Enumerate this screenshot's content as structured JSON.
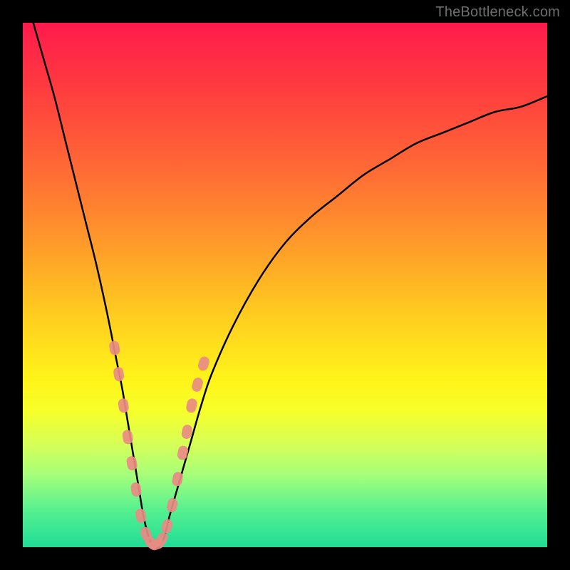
{
  "watermark": "TheBottleneck.com",
  "colors": {
    "frame": "#000000",
    "curve": "#000000",
    "marker_fill": "#e98b84",
    "marker_stroke": "#e98b84"
  },
  "chart_data": {
    "type": "line",
    "title": "",
    "xlabel": "",
    "ylabel": "",
    "xlim": [
      0,
      100
    ],
    "ylim": [
      0,
      100
    ],
    "grid": false,
    "legend": false,
    "series": [
      {
        "name": "bottleneck-curve",
        "x": [
          2,
          4,
          6,
          8,
          10,
          12,
          14,
          16,
          18,
          19,
          20,
          21,
          22,
          23,
          24,
          25,
          26,
          27,
          28,
          30,
          32,
          34,
          36,
          40,
          45,
          50,
          55,
          60,
          65,
          70,
          75,
          80,
          85,
          90,
          95,
          100
        ],
        "y": [
          100,
          93,
          86,
          78,
          70,
          62,
          54,
          45,
          35,
          30,
          24,
          18,
          12,
          6,
          2,
          0,
          0,
          2,
          6,
          13,
          20,
          27,
          33,
          42,
          51,
          58,
          63,
          67,
          71,
          74,
          77,
          79,
          81,
          83,
          84,
          86
        ]
      }
    ],
    "annotations": [
      {
        "type": "markers",
        "shape": "capsule",
        "comment": "salmon capsule markers along the lower V of the curve",
        "points_xy": [
          [
            17.5,
            38
          ],
          [
            18.3,
            33
          ],
          [
            19.2,
            27
          ],
          [
            20.0,
            21
          ],
          [
            20.8,
            16
          ],
          [
            21.6,
            11
          ],
          [
            22.5,
            6
          ],
          [
            23.5,
            2.5
          ],
          [
            24.5,
            0.8
          ],
          [
            25.5,
            0.5
          ],
          [
            26.5,
            1.5
          ],
          [
            27.5,
            4
          ],
          [
            28.5,
            8
          ],
          [
            29.5,
            13
          ],
          [
            30.5,
            18
          ],
          [
            31.3,
            22
          ],
          [
            32.2,
            27
          ],
          [
            33.3,
            31
          ],
          [
            34.5,
            35
          ]
        ]
      }
    ]
  }
}
